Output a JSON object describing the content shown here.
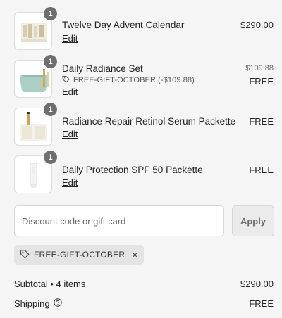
{
  "items": [
    {
      "qty": "1",
      "name": "Twelve Day Advent Calendar",
      "edit": "Edit",
      "price": "$290.00"
    },
    {
      "qty": "1",
      "name": "Daily Radiance Set",
      "edit": "Edit",
      "original_price": "$109.88",
      "price": "FREE",
      "discount": "FREE-GIFT-OCTOBER (-$109.88)"
    },
    {
      "qty": "1",
      "name": "Radiance Repair Retinol Serum Packette",
      "edit": "Edit",
      "price": "FREE"
    },
    {
      "qty": "1",
      "name": "Daily Protection SPF 50 Packette",
      "edit": "Edit",
      "price": "FREE"
    }
  ],
  "discount": {
    "placeholder": "Discount code or gift card",
    "apply_label": "Apply",
    "applied_code": "FREE-GIFT-OCTOBER",
    "remove_icon": "×"
  },
  "summary": {
    "subtotal_label": "Subtotal • 4 items",
    "subtotal_value": "$290.00",
    "shipping_label": "Shipping",
    "shipping_value": "FREE"
  },
  "icons": {
    "tag": "tag-icon",
    "help": "question-circle-icon",
    "close": "close-icon"
  },
  "colors": {
    "background": "#f5f5f5",
    "badge": "#6e6e6e",
    "chip": "#e4e4e4",
    "apply_button": "#ebebeb"
  }
}
